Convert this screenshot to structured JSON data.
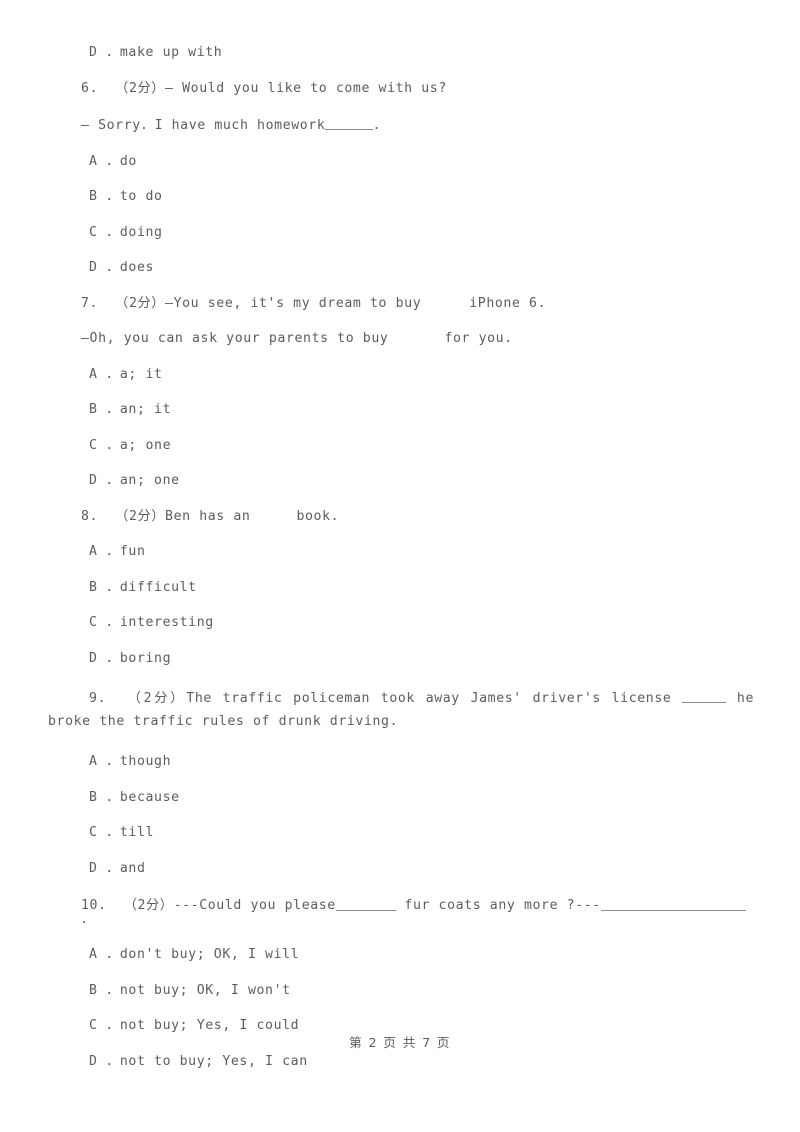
{
  "document": {
    "page_footer": "第 2 页 共 7 页",
    "page_number": "2",
    "total_pages": "7"
  },
  "orphan_option": {
    "label": "D ．make up with"
  },
  "questions": [
    {
      "number": "6.",
      "marks": "（2分）",
      "stem_part1": "6.  （2分）— Would you like to come with us?",
      "dialog_prefix": "— Sorry．I have much homework",
      "dialog_suffix": "．",
      "options": [
        "A ．do",
        "B ．to do",
        "C ．doing",
        "D ．does"
      ]
    },
    {
      "number": "7.",
      "marks": "（2分）",
      "stem_prefix": "7.  （2分）—You see, it's my dream to buy",
      "stem_suffix": "iPhone 6.",
      "dialog_prefix": "—Oh, you can ask your parents to buy",
      "dialog_suffix": "for you.",
      "options": [
        "A ．a; it",
        "B ．an; it",
        "C ．a; one",
        "D ．an; one"
      ]
    },
    {
      "number": "8.",
      "marks": "（2分）",
      "stem_prefix": "8.  （2分）Ben has an",
      "stem_suffix": "book.",
      "options": [
        "A ．fun",
        "B ．difficult",
        "C ．interesting",
        "D ．boring"
      ]
    },
    {
      "number": "9.",
      "marks": "（2分）",
      "stem_prefix": "9.  （2分）The traffic policeman took away James' driver's license ",
      "stem_suffix": " he broke the traffic rules of drunk driving.",
      "options": [
        "A ．though",
        "B ．because",
        "C ．till",
        "D ．and"
      ]
    },
    {
      "number": "10.",
      "marks": "（2分）",
      "stem_prefix": "10.  （2分）---Could you please",
      "stem_middle": " fur coats any more ?---",
      "stem_suffix": "．",
      "options": [
        "A ．don't buy; OK, I will",
        "B ．not buy; OK, I won't",
        "C ．not buy; Yes, I could",
        "D ．not to buy; Yes, I can"
      ]
    }
  ]
}
